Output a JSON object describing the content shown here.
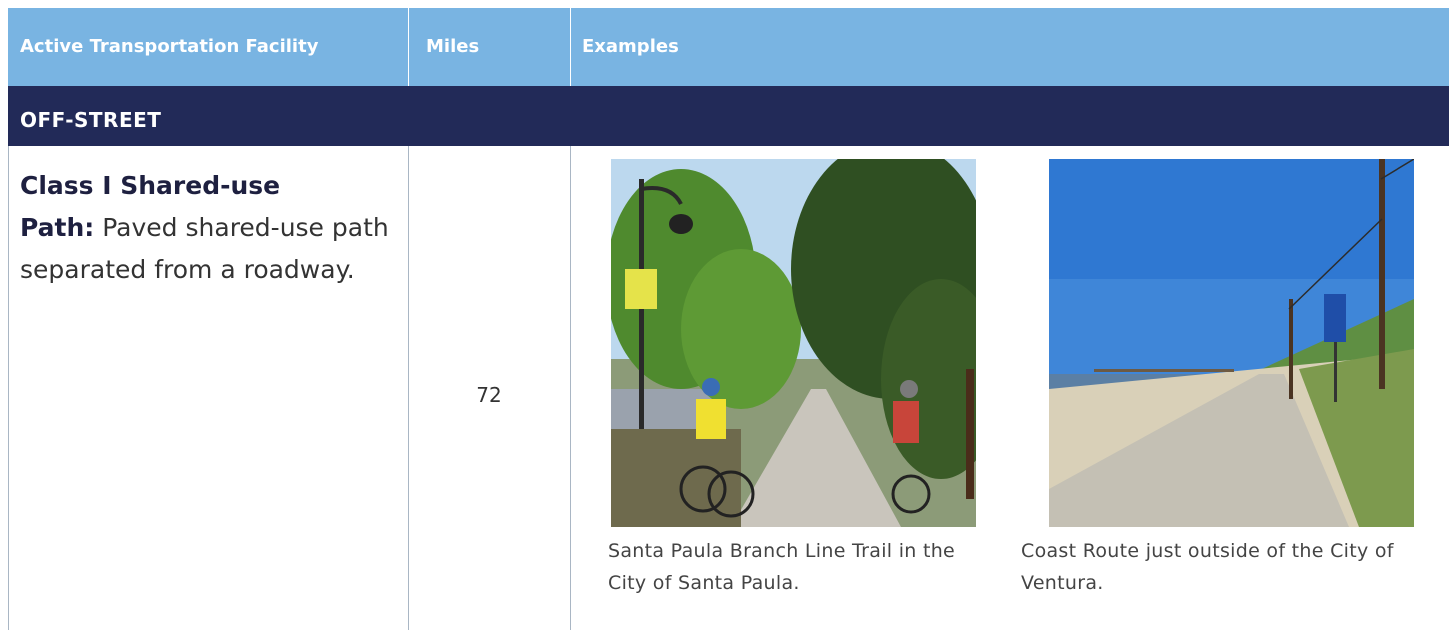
{
  "header": {
    "col_facility": "Active Transportation Facility",
    "col_miles": "Miles",
    "col_examples": "Examples",
    "background": "#79b4e2"
  },
  "section": {
    "label": "OFF-STREET",
    "background": "#222a58"
  },
  "row": {
    "title": "Class I Shared-use",
    "term": "Path:",
    "definition": "Paved shared-use path separated from a roadway.",
    "miles": "72"
  },
  "examples": [
    {
      "image": "Santa Paula Branch Line Trail photo",
      "caption": "Santa Paula Branch Line Trail in the City of Santa Paula."
    },
    {
      "image": "Coast Route photo",
      "caption": "Coast Route just outside of the City of Ventura."
    }
  ]
}
